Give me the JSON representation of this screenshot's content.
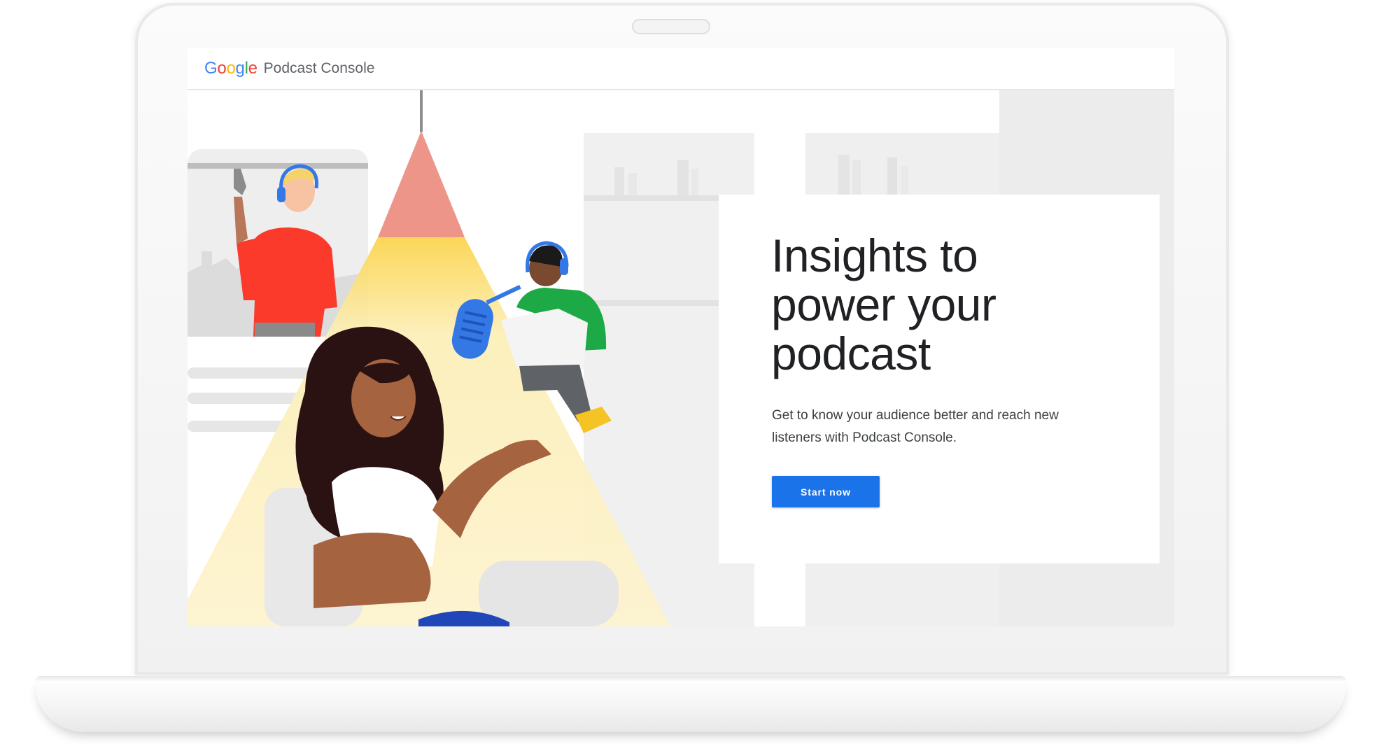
{
  "header": {
    "logo_letters": [
      {
        "char": "G",
        "color": "#4285F4"
      },
      {
        "char": "o",
        "color": "#EA4335"
      },
      {
        "char": "o",
        "color": "#FBBC05"
      },
      {
        "char": "g",
        "color": "#4285F4"
      },
      {
        "char": "l",
        "color": "#34A853"
      },
      {
        "char": "e",
        "color": "#EA4335"
      }
    ],
    "product_name": "Podcast Console"
  },
  "hero": {
    "title_lines": [
      "Insights to",
      "power your",
      "podcast"
    ],
    "description_lines": [
      "Get to know your audience better and reach new",
      "listeners with Podcast Console."
    ],
    "cta_label": "Start now"
  },
  "colors": {
    "accent": "#1a73e8",
    "lamp_shade": "#ee958a",
    "light_cone": "#fbefbf",
    "mic": "#3478e6",
    "red_shirt": "#fb3a2c",
    "green_sweater": "#1daa46",
    "shoe": "#f6c324"
  },
  "icons": [
    "microphone-icon",
    "headphones-icon"
  ]
}
